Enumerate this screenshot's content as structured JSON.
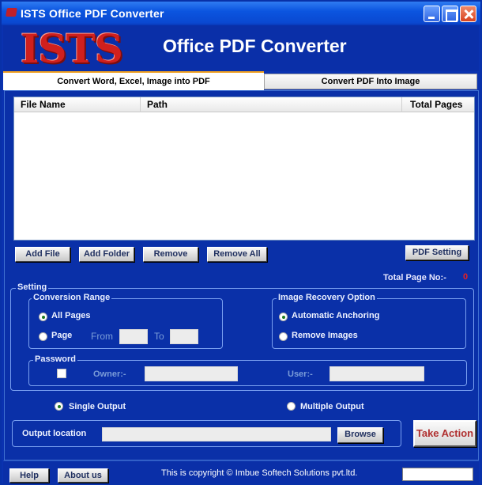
{
  "window": {
    "title": "ISTS Office PDF Converter"
  },
  "banner": {
    "logo_text": "ISTS",
    "title": "Office PDF Converter"
  },
  "tabs": [
    {
      "label": "Convert Word, Excel, Image into PDF",
      "active": true
    },
    {
      "label": "Convert PDF Into Image",
      "active": false
    }
  ],
  "file_list": {
    "columns": [
      "File Name",
      "Path",
      "Total Pages"
    ],
    "rows": []
  },
  "buttons": {
    "add_file": "Add File",
    "add_folder": "Add Folder",
    "remove": "Remove",
    "remove_all": "Remove All",
    "pdf_setting": "PDF Setting",
    "browse": "Browse",
    "take_action": "Take Action",
    "help": "Help",
    "about_us": "About us"
  },
  "total_pages": {
    "label": "Total Page No:-",
    "value": "0"
  },
  "setting": {
    "legend": "Setting",
    "conversion_range": {
      "legend": "Conversion Range",
      "all_pages": "All Pages",
      "page": "Page",
      "from": "From",
      "to": "To",
      "selected": "all_pages"
    },
    "image_recovery": {
      "legend": "Image Recovery Option",
      "automatic_anchoring": "Automatic Anchoring",
      "remove_images": "Remove Images",
      "selected": "automatic_anchoring"
    },
    "password": {
      "legend": "Password",
      "owner": "Owner:-",
      "user": "User:-",
      "checked": false
    }
  },
  "output": {
    "single": "Single Output",
    "multiple": "Multiple Output",
    "selected": "single",
    "location_label": "Output location",
    "location_value": ""
  },
  "footer": {
    "copyright": "This is copyright ©  Imbue Softech Solutions pvt.ltd."
  },
  "colors": {
    "window_bg": "#0a30a8",
    "titlebar": "#0b55e0",
    "logo_red": "#d0201e",
    "take_action_text": "#b03030"
  }
}
